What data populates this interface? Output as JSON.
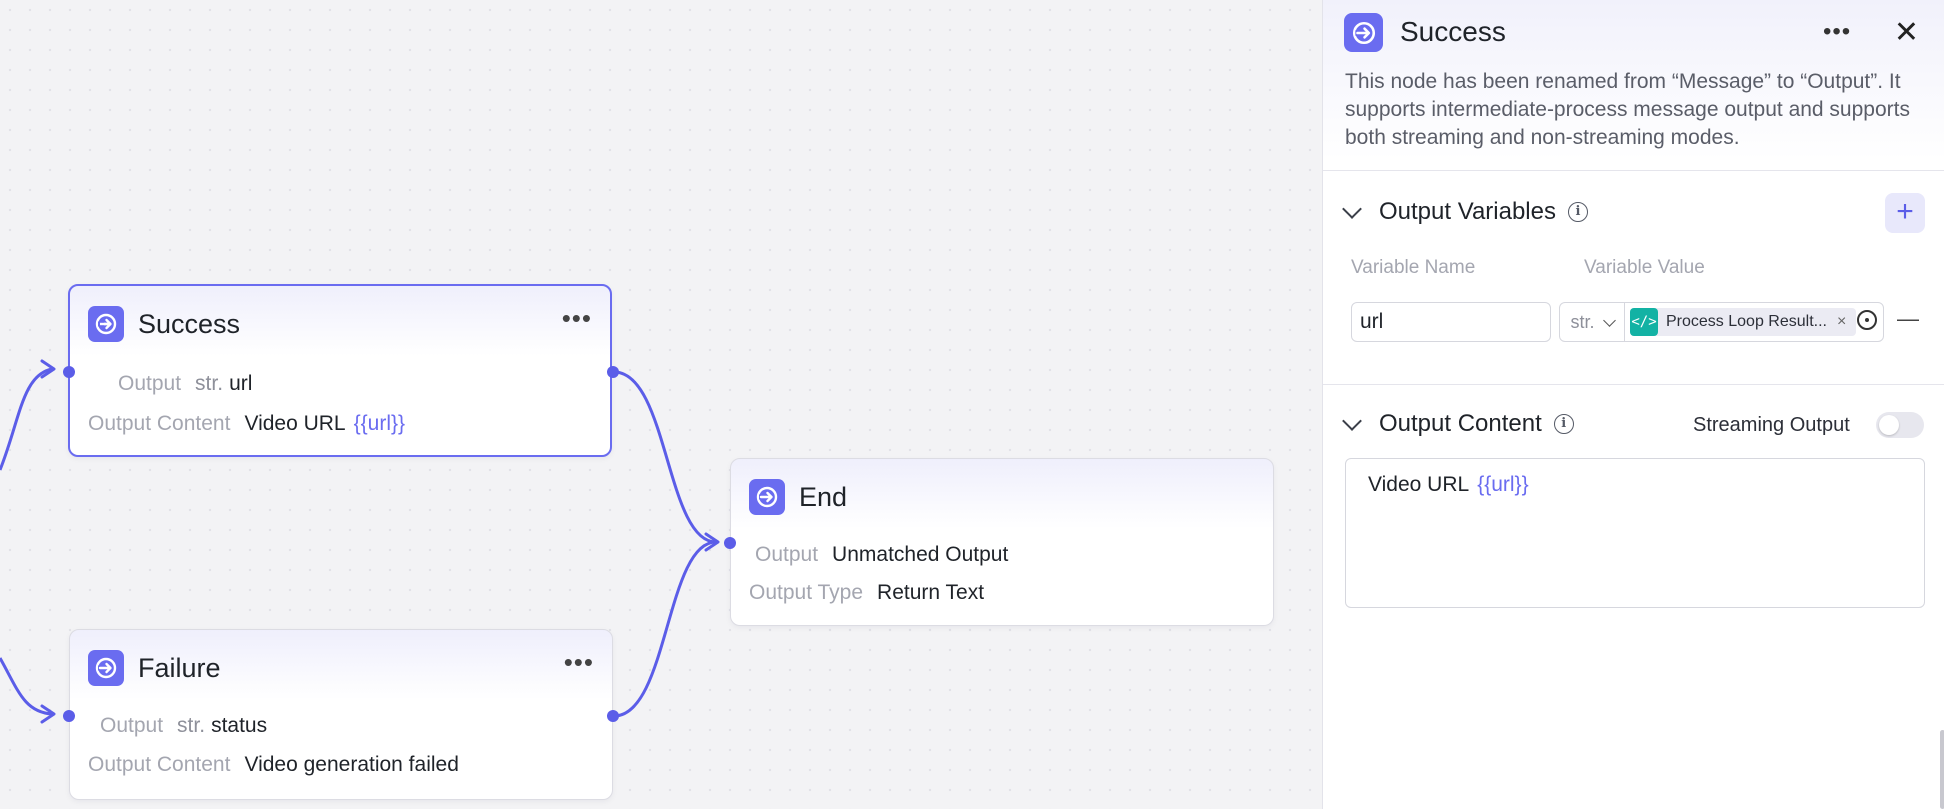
{
  "nodes": {
    "success": {
      "title": "Success",
      "menu": "•••",
      "output_label": "Output",
      "output_type": "str.",
      "output_value": "url",
      "content_label": "Output Content",
      "content_text": "Video URL",
      "content_var": "{{url}}"
    },
    "failure": {
      "title": "Failure",
      "menu": "•••",
      "output_label": "Output",
      "output_type": "str.",
      "output_value": "status",
      "content_label": "Output Content",
      "content_text": "Video generation failed"
    },
    "end": {
      "title": "End",
      "output_label": "Output",
      "output_value": "Unmatched Output",
      "type_label": "Output Type",
      "type_value": "Return Text"
    }
  },
  "panel": {
    "title": "Success",
    "menu": "•••",
    "close": "✕",
    "description": "This node has been renamed from “Message” to “Output”. It supports intermediate-process message output and supports both streaming and non-streaming modes.",
    "output_variables": {
      "heading": "Output Variables",
      "add": "+",
      "col_name": "Variable Name",
      "col_value": "Variable Value",
      "rows": [
        {
          "name": "url",
          "type": "str.",
          "ref_icon": "</>",
          "ref_label": "Process Loop Result...",
          "ref_remove": "×",
          "remove": "—"
        }
      ]
    },
    "output_content": {
      "heading": "Output Content",
      "streaming_label": "Streaming Output",
      "streaming_on": false,
      "text": "Video URL",
      "var": "{{url}}"
    }
  },
  "colors": {
    "accent": "#6a6cf0",
    "edge": "#5b5de8",
    "code_chip": "#13b2a4"
  }
}
